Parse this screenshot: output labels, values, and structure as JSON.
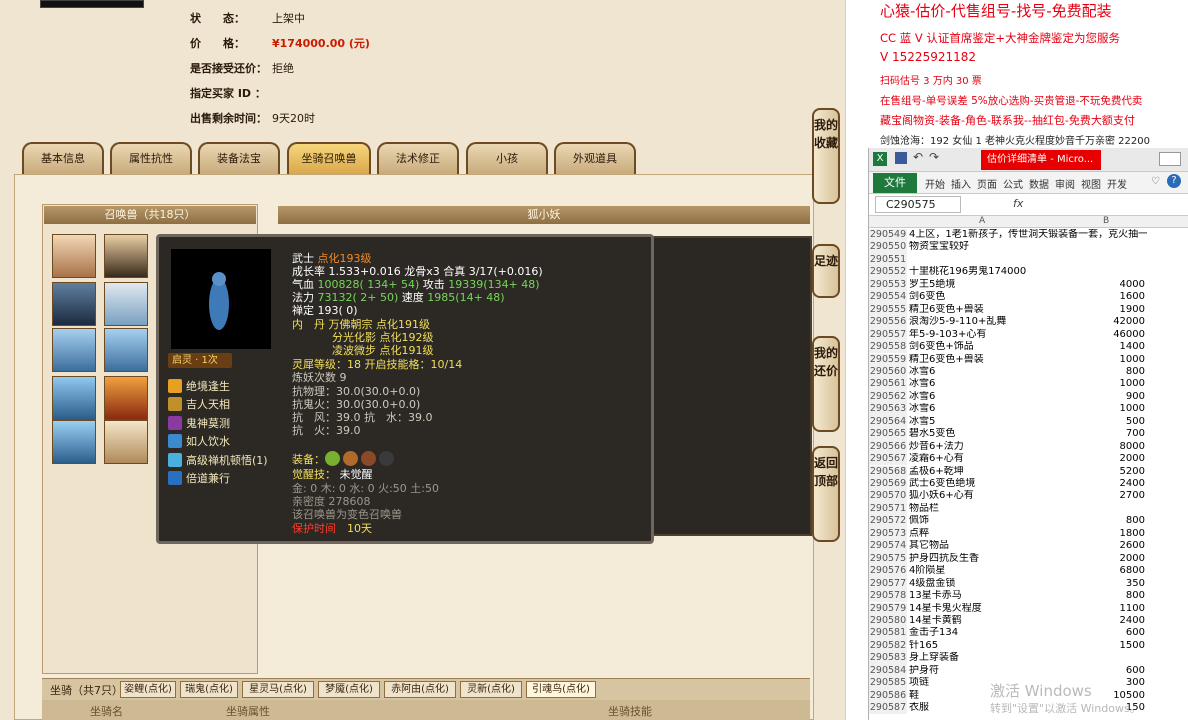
{
  "game": {
    "info": [
      {
        "key": "状　　态：",
        "value": "上架中"
      },
      {
        "key": "价　　格：",
        "value": "¥174000.00 (元)"
      },
      {
        "key": "是否接受还价：",
        "value": "拒绝"
      },
      {
        "key": "指定买家 ID ：",
        "value": ""
      },
      {
        "key": "出售剩余时间：",
        "value": "9天20时"
      }
    ],
    "tabs": [
      "基本信息",
      "属性抗性",
      "装备法宝",
      "坐骑召唤兽",
      "法术修正",
      "小孩",
      "外观道具"
    ],
    "active_tab": "坐骑召唤兽",
    "summon_title": "召唤兽（共18只）",
    "pet_title": "狐小妖",
    "side_buttons": [
      "我的收藏",
      "足迹",
      "我的还价",
      "返回顶部"
    ],
    "tooltip": {
      "name_line": "武士",
      "name_tag": "点化193级",
      "growth": "成长率 1.533+0.016 龙骨x3 合真 3/17(+0.016)",
      "hp_label": "气血",
      "hp": "100828( 134+ 54)",
      "atk_label": "攻击",
      "atk": "19339(134+ 48)",
      "mp_label": "法力",
      "mp": "73132( 2+ 50)",
      "spd_label": "速度",
      "spd": "1985(14+ 48)",
      "zen": "禅定 193( 0)",
      "neidan1": "内　丹 万佛朝宗 点化191级",
      "neidan2": "分光化影 点化192级",
      "neidan3": "凌波微步 点化191级",
      "spirit": "灵犀等级：18 开启技能格：10/14",
      "demon": "炼妖次数 9",
      "res1": "抗物理：30.0(30.0+0.0)",
      "res2": "抗鬼火：30.0(30.0+0.0)",
      "res3": "抗　风：39.0 抗　水：39.0",
      "res4": "抗　火：39.0",
      "equip_label": "装备：",
      "awaken_label": "觉醒技：",
      "awaken_value": "未觉醒",
      "elements": "金: 0 木: 0 水: 0 火:50 土:50",
      "intimacy": "亲密度 278608",
      "changed": "该召唤兽为变色召唤兽",
      "protect_label": "保护时间",
      "protect_value": "10天",
      "qiling": "启灵 · 1次",
      "skills": [
        "绝境逢生",
        "吉人天相",
        "鬼神莫测",
        "如人饮水",
        "高级禅机顿悟(1)",
        "倍道兼行"
      ]
    },
    "mount_label": "坐骑（共7只）",
    "mount_tabs": [
      "姿鲤(点化)",
      "瑞鬼(点化)",
      "星灵马(点化)",
      "梦魇(点化)",
      "赤阿由(点化)",
      "灵新(点化)",
      "引魂鸟(点化)"
    ],
    "mount_headers": [
      "坐骑名",
      "坐骑属性",
      "坐骑技能"
    ]
  },
  "ads": [
    "心猿-估价-代售组号-找号-免费配装",
    "CC 蓝 V 认证首席鉴定+大神金牌鉴定为您服务",
    "V 15225921182",
    "扫码估号 3 万内 30 票",
    "在售组号-单号误差 5%放心选购-买贵管退-不玩免费代卖",
    "藏宝阁物资-装备-角色-联系我--抽红包-免费大额支付",
    "剑蚀沧海：192 女仙 1 老神火克火程度妙音千万亲密 22200"
  ],
  "excel": {
    "title": "估价详细清单 - Micro...",
    "ribbon_file": "文件",
    "ribbon_tabs": [
      "开始",
      "插入",
      "页面",
      "公式",
      "数据",
      "审阅",
      "视图",
      "开发"
    ],
    "namebox": "C290575",
    "fx": "fx",
    "col_a": "A",
    "col_b": "B",
    "rows": [
      {
        "n": "290549",
        "a": "4上区，1老1新孩子，传世洞天锻装备一套，克火抽一套",
        "b": ""
      },
      {
        "n": "290550",
        "a": "物资宝宝较好",
        "b": ""
      },
      {
        "n": "290551",
        "a": "",
        "b": ""
      },
      {
        "n": "290552",
        "a": "十里桃花196男鬼174000",
        "b": ""
      },
      {
        "n": "290553",
        "a": "罗王5绝境",
        "b": "4000"
      },
      {
        "n": "290554",
        "a": "剑6变色",
        "b": "1600"
      },
      {
        "n": "290555",
        "a": "精卫6变色+兽装",
        "b": "1900"
      },
      {
        "n": "290556",
        "a": "浪淘沙5-9-110+乱舞",
        "b": "42000"
      },
      {
        "n": "290557",
        "a": "年5-9-103+心有",
        "b": "46000"
      },
      {
        "n": "290558",
        "a": "剑6变色+饰品",
        "b": "1400"
      },
      {
        "n": "290559",
        "a": "精卫6变色+兽装",
        "b": "1000"
      },
      {
        "n": "290560",
        "a": "冰雪6",
        "b": "800"
      },
      {
        "n": "290561",
        "a": "冰雪6",
        "b": "1000"
      },
      {
        "n": "290562",
        "a": "冰雪6",
        "b": "900"
      },
      {
        "n": "290563",
        "a": "冰雪6",
        "b": "1000"
      },
      {
        "n": "290564",
        "a": "冰雪5",
        "b": "500"
      },
      {
        "n": "290565",
        "a": "碧水5变色",
        "b": "700"
      },
      {
        "n": "290566",
        "a": "炒音6+法力",
        "b": "8000"
      },
      {
        "n": "290567",
        "a": "凌霜6+心有",
        "b": "2000"
      },
      {
        "n": "290568",
        "a": "孟极6+乾坤",
        "b": "5200"
      },
      {
        "n": "290569",
        "a": "武士6变色绝境",
        "b": "2400"
      },
      {
        "n": "290570",
        "a": "狐小妖6+心有",
        "b": "2700"
      },
      {
        "n": "290571",
        "a": "物品栏",
        "b": ""
      },
      {
        "n": "290572",
        "a": "佩饰",
        "b": "800"
      },
      {
        "n": "290573",
        "a": "点粹",
        "b": "1800"
      },
      {
        "n": "290574",
        "a": "其它物品",
        "b": "2600"
      },
      {
        "n": "290575",
        "a": "护身四抗反生香",
        "b": "2000"
      },
      {
        "n": "290576",
        "a": "4阶陨星",
        "b": "6800"
      },
      {
        "n": "290577",
        "a": "4级盘金锁",
        "b": "350"
      },
      {
        "n": "290578",
        "a": "13星卡赤马",
        "b": "800"
      },
      {
        "n": "290579",
        "a": "14星卡鬼火程度",
        "b": "1100"
      },
      {
        "n": "290580",
        "a": "14星卡黄鹤",
        "b": "2400"
      },
      {
        "n": "290581",
        "a": "金击子134",
        "b": "600"
      },
      {
        "n": "290582",
        "a": "针165",
        "b": "1500"
      },
      {
        "n": "290583",
        "a": "身上穿装备",
        "b": ""
      },
      {
        "n": "290584",
        "a": "护身符",
        "b": "600"
      },
      {
        "n": "290585",
        "a": "项链",
        "b": "300"
      },
      {
        "n": "290586",
        "a": "鞋",
        "b": "10500"
      },
      {
        "n": "290587",
        "a": "衣服",
        "b": "150"
      }
    ]
  },
  "watermark": "激活 Windows",
  "watermark_sub": "转到\"设置\"以激活 Windows。"
}
